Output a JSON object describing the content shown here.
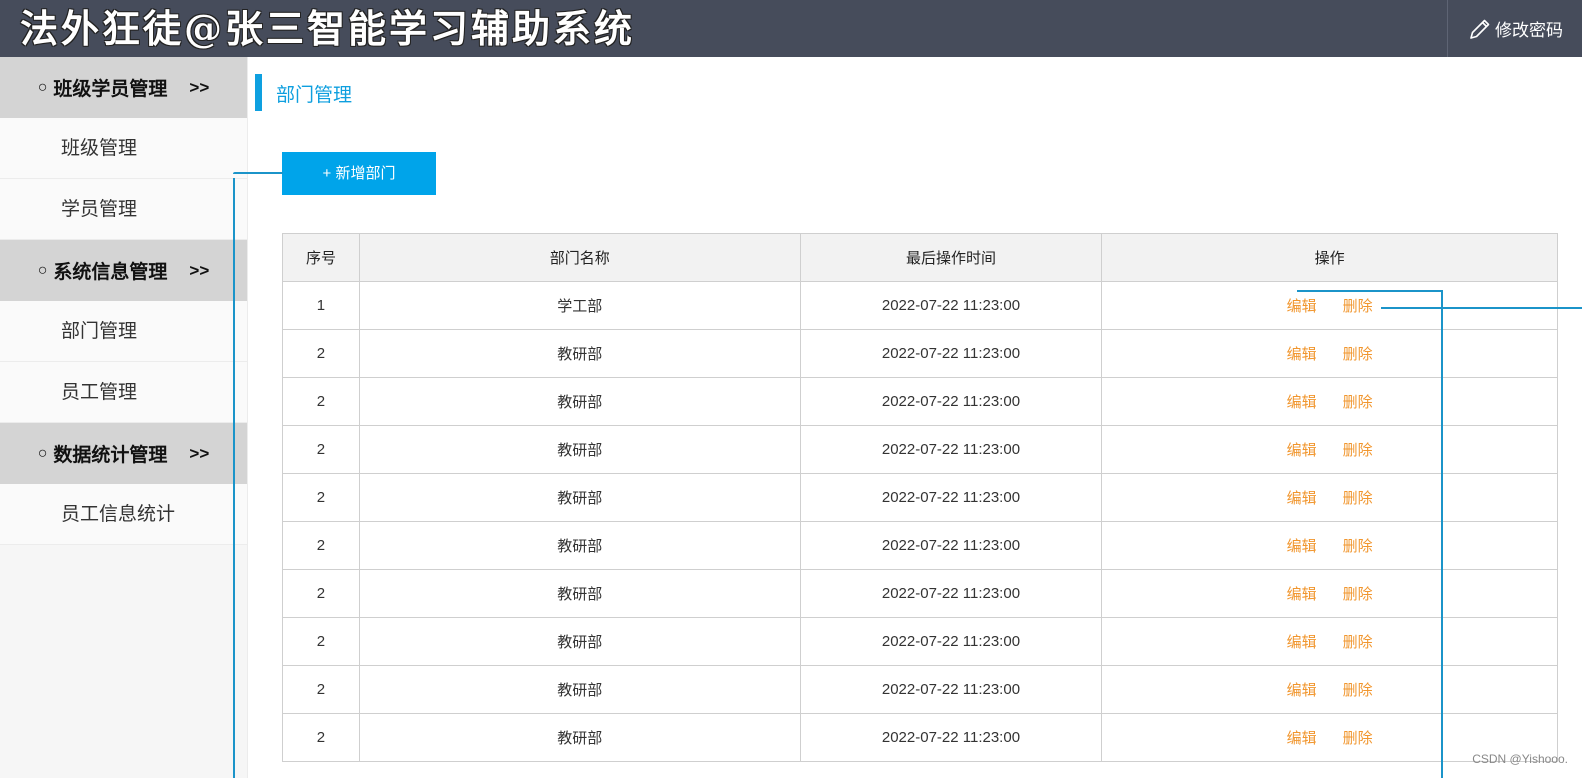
{
  "header": {
    "title": "法外狂徒@张三智能学习辅助系统",
    "change_password_label": "修改密码",
    "pencil_icon": "pencil-icon"
  },
  "sidebar": {
    "groups": [
      {
        "label": "班级学员管理",
        "arrow": ">>",
        "items": [
          {
            "label": "班级管理"
          },
          {
            "label": "学员管理"
          }
        ]
      },
      {
        "label": "系统信息管理",
        "arrow": ">>",
        "items": [
          {
            "label": "部门管理"
          },
          {
            "label": "员工管理"
          }
        ]
      },
      {
        "label": "数据统计管理",
        "arrow": ">>",
        "items": [
          {
            "label": "员工信息统计"
          }
        ]
      }
    ]
  },
  "main": {
    "page_title": "部门管理",
    "add_button_label": "+ 新增部门",
    "table": {
      "headers": [
        "序号",
        "部门名称",
        "最后操作时间",
        "操作"
      ],
      "rows": [
        {
          "index": "1",
          "name": "学工部",
          "time": "2022-07-22 11:23:00"
        },
        {
          "index": "2",
          "name": "教研部",
          "time": "2022-07-22 11:23:00"
        },
        {
          "index": "2",
          "name": "教研部",
          "time": "2022-07-22 11:23:00"
        },
        {
          "index": "2",
          "name": "教研部",
          "time": "2022-07-22 11:23:00"
        },
        {
          "index": "2",
          "name": "教研部",
          "time": "2022-07-22 11:23:00"
        },
        {
          "index": "2",
          "name": "教研部",
          "time": "2022-07-22 11:23:00"
        },
        {
          "index": "2",
          "name": "教研部",
          "time": "2022-07-22 11:23:00"
        },
        {
          "index": "2",
          "name": "教研部",
          "time": "2022-07-22 11:23:00"
        },
        {
          "index": "2",
          "name": "教研部",
          "time": "2022-07-22 11:23:00"
        },
        {
          "index": "2",
          "name": "教研部",
          "time": "2022-07-22 11:23:00"
        }
      ],
      "edit_label": "编辑",
      "delete_label": "删除"
    }
  },
  "colors": {
    "header_bg": "#464c5b",
    "accent": "#00a4ea",
    "link_orange": "#f1962e",
    "annotation": "#1b94c9"
  },
  "watermark": "CSDN @Yishooo."
}
